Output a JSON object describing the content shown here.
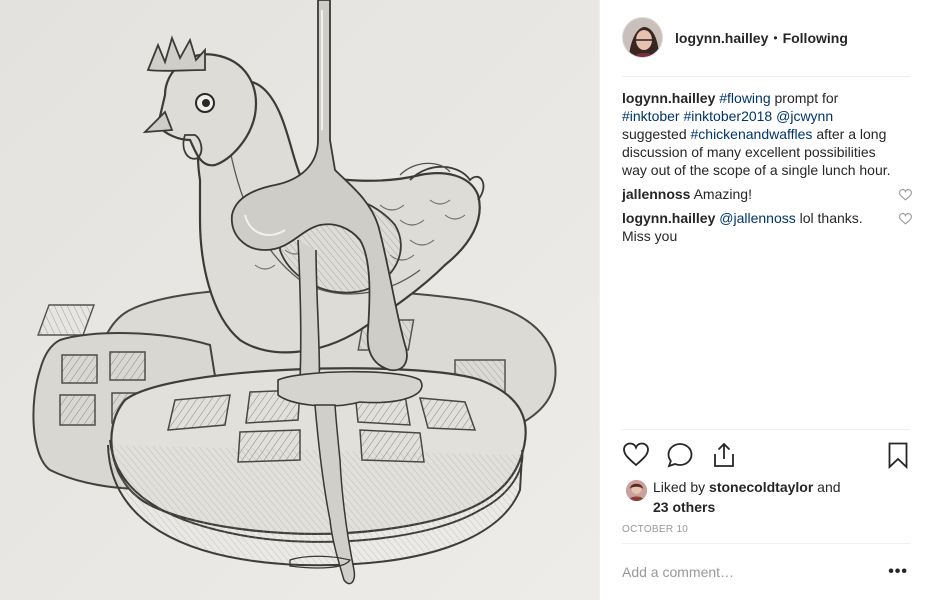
{
  "header": {
    "username": "logynn.hailley",
    "separator": "•",
    "follow_status": "Following"
  },
  "caption": {
    "username": "logynn.hailley",
    "parts": [
      {
        "text": " ",
        "tag": false
      },
      {
        "text": "#flowing",
        "tag": true
      },
      {
        "text": " prompt for ",
        "tag": false
      },
      {
        "text": "#inktober",
        "tag": true
      },
      {
        "text": " ",
        "tag": false
      },
      {
        "text": "#inktober2018",
        "tag": true
      },
      {
        "text": " ",
        "tag": false
      },
      {
        "text": "@jcwynn",
        "tag": true
      },
      {
        "text": " suggested ",
        "tag": false
      },
      {
        "text": "#chickenandwaffles",
        "tag": true
      },
      {
        "text": " after a long discussion of many excellent possibilities way out of the scope of a single lunch hour.",
        "tag": false
      }
    ]
  },
  "comments": [
    {
      "username": "jallennoss",
      "text": "Amazing!"
    },
    {
      "username": "logynn.hailley",
      "mention": "@jallennoss",
      "text": " lol thanks. Miss you"
    }
  ],
  "likes": {
    "prefix": "Liked by ",
    "liker": "stonecoldtaylor",
    "and": " and",
    "others": "23 others"
  },
  "date": "OCTOBER 10",
  "add_comment": {
    "placeholder": "Add a comment…",
    "more": "•••"
  },
  "colors": {
    "text": "#262626",
    "link": "#003569",
    "muted": "#999999",
    "divider": "#efefef",
    "image_bg": "#e9e7e3"
  },
  "icons": [
    "heart-icon",
    "comment-icon",
    "share-icon",
    "bookmark-icon",
    "more-options-icon"
  ]
}
